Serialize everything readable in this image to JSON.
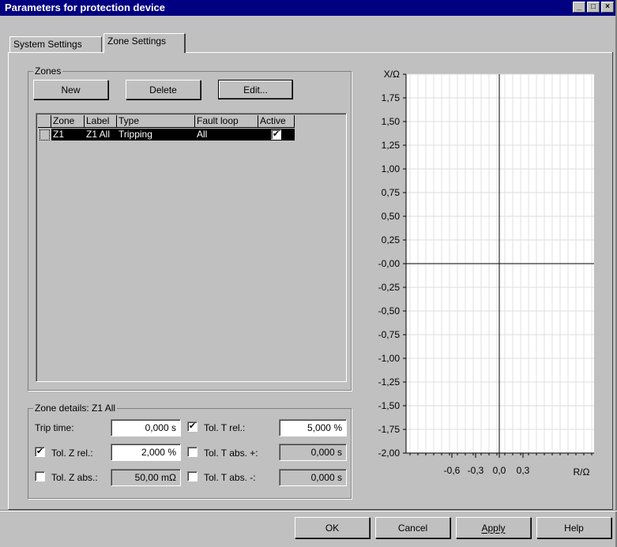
{
  "window": {
    "title": "Parameters for protection device"
  },
  "tabs": [
    {
      "label": "System Settings"
    },
    {
      "label": "Zone Settings"
    }
  ],
  "zones": {
    "group_title": "Zones",
    "buttons": {
      "new": "New",
      "delete": "Delete",
      "edit": "Edit..."
    },
    "columns": [
      "Zone",
      "Label",
      "Type",
      "Fault loop",
      "Active"
    ],
    "rows": [
      {
        "zone": "Z1",
        "label": "Z1 All",
        "type": "Tripping",
        "fault_loop": "All",
        "active": true
      }
    ]
  },
  "zone_details": {
    "group_title": "Zone details: Z1 All",
    "trip_time_label": "Trip time:",
    "trip_time_value": "0,000  s",
    "tol_t_rel_label": "Tol. T rel.:",
    "tol_t_rel_checked": true,
    "tol_t_rel_value": "5,000  %",
    "tol_z_rel_label": "Tol. Z rel.:",
    "tol_z_rel_checked": true,
    "tol_z_rel_value": "2,000  %",
    "tol_t_abs_plus_label": "Tol. T abs. +:",
    "tol_t_abs_plus_checked": false,
    "tol_t_abs_plus_value": "0,000  s",
    "tol_z_abs_label": "Tol. Z abs.:",
    "tol_z_abs_checked": false,
    "tol_z_abs_value": "50,00  mΩ",
    "tol_t_abs_minus_label": "Tol. T abs. -:",
    "tol_t_abs_minus_checked": false,
    "tol_t_abs_minus_value": "0,000  s"
  },
  "chart_data": {
    "type": "scatter",
    "ylabel": "X/Ω",
    "xlabel": "R/Ω",
    "y_ticks": [
      "1,75",
      "1,50",
      "1,25",
      "1,00",
      "0,75",
      "0,50",
      "0,25",
      "-0,00",
      "-0,25",
      "-0,50",
      "-0,75",
      "-1,00",
      "-1,25",
      "-1,50",
      "-1,75",
      "-2,00"
    ],
    "x_ticks": [
      "-0,6",
      "-0,3",
      "0,0",
      "0,3"
    ],
    "ylim": [
      -2.0,
      2.0
    ],
    "grid": true
  },
  "footer": {
    "ok": "OK",
    "cancel": "Cancel",
    "apply": "Apply",
    "help": "Help"
  },
  "check_mark": "✔"
}
